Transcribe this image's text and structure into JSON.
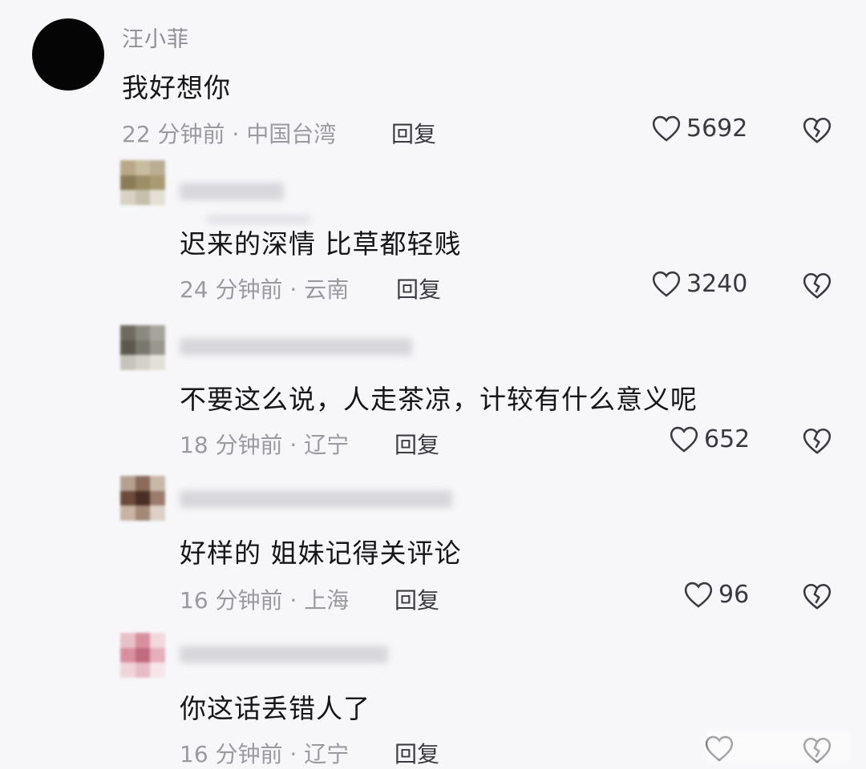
{
  "comments": [
    {
      "username": "汪小菲",
      "text": "我好想你",
      "time_location": "22 分钟前 · 中国台湾",
      "reply_label": "回复",
      "likes": "5692"
    },
    {
      "text": "迟来的深情  比草都轻贱",
      "time_location": "24 分钟前 · 云南",
      "reply_label": "回复",
      "likes": "3240"
    },
    {
      "text": "不要这么说，人走茶凉，计较有什么意义呢",
      "time_location": "18 分钟前 · 辽宁",
      "reply_label": "回复",
      "likes": "652"
    },
    {
      "text": "好样的  姐妹记得关评论",
      "time_location": "16 分钟前 · 上海",
      "reply_label": "回复",
      "likes": "96"
    },
    {
      "text": "你这话丢错人了",
      "time_location": "16 分钟前 · 辽宁",
      "reply_label": "回复",
      "likes": ""
    }
  ],
  "icons": {
    "like": "heart-outline-icon",
    "dislike": "broken-heart-icon"
  },
  "colors": {
    "background": "#f7f7f9",
    "meta_text": "#9a9a9f",
    "main_text": "#161616"
  }
}
